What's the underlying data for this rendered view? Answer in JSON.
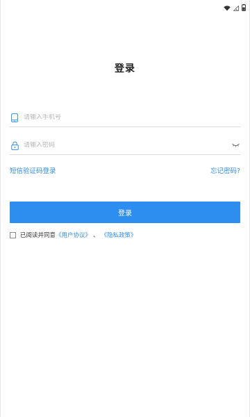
{
  "status_bar": {
    "icons": [
      "wifi-icon",
      "signal-off-icon",
      "battery-icon"
    ]
  },
  "page": {
    "title": "登录"
  },
  "form": {
    "phone_placeholder": "请输入手机号",
    "phone_icon": "phone-icon",
    "password_placeholder": "请输入密码",
    "password_icon": "lock-icon",
    "password_toggle_icon": "eye-closed-icon",
    "sms_login_label": "短信验证码登录",
    "forgot_password_label": "忘记密码?",
    "login_button_label": "登录"
  },
  "agreement": {
    "prefix": "已阅读并同意",
    "user_agreement": "《用户协议》",
    "separator": "、",
    "privacy_policy": "《隐私政策》",
    "checked": false
  },
  "colors": {
    "accent": "#2d8ef0",
    "link": "#2f8ee9",
    "placeholder": "#b5b5b5",
    "divider": "#d9d9d9"
  }
}
